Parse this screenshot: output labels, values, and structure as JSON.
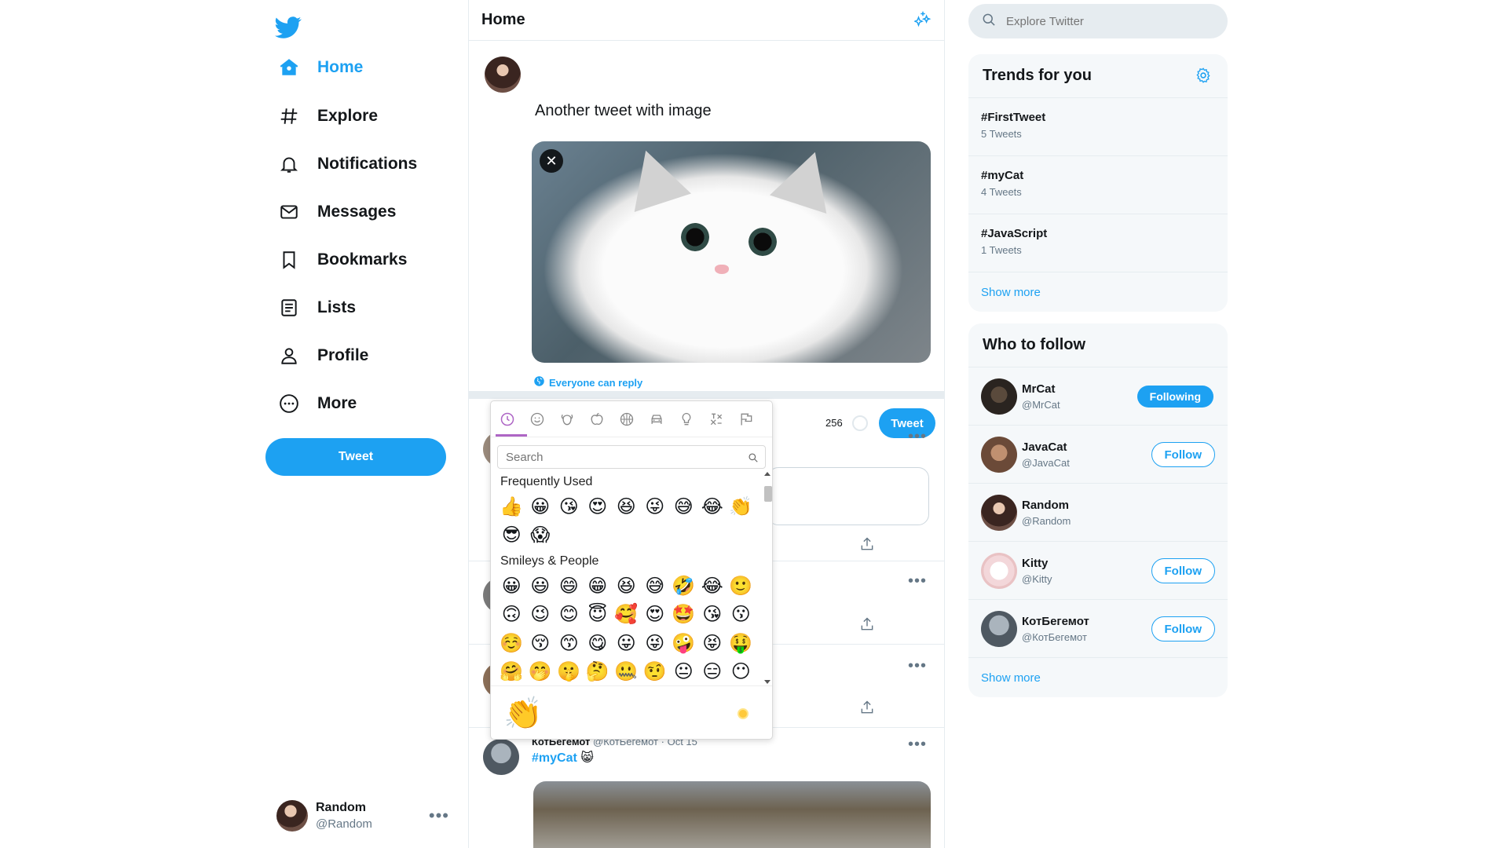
{
  "colors": {
    "accent": "#1da1f2",
    "text": "#14171a",
    "muted": "#657786",
    "border": "#e6ecf0",
    "picker_accent": "#ae65c5"
  },
  "nav": {
    "items": [
      {
        "label": "Home",
        "icon": "home-icon"
      },
      {
        "label": "Explore",
        "icon": "hashtag-icon"
      },
      {
        "label": "Notifications",
        "icon": "bell-icon"
      },
      {
        "label": "Messages",
        "icon": "envelope-icon"
      },
      {
        "label": "Bookmarks",
        "icon": "bookmark-icon"
      },
      {
        "label": "Lists",
        "icon": "list-icon"
      },
      {
        "label": "Profile",
        "icon": "person-icon"
      },
      {
        "label": "More",
        "icon": "more-circle-icon"
      }
    ],
    "tweet_label": "Tweet"
  },
  "account": {
    "name": "Random",
    "handle": "@Random"
  },
  "header": {
    "title": "Home"
  },
  "compose": {
    "text": "Another tweet with image",
    "reply_setting": "Everyone can reply",
    "counter": "256",
    "tweet_label": "Tweet"
  },
  "feed": {
    "last_item": {
      "name": "КотБегемот",
      "handle": "@КотБегемот",
      "sep": "·",
      "date": "Oct 15",
      "hashtag": "#myCat",
      "emoji": "😸"
    }
  },
  "emoji_picker": {
    "search_placeholder": "Search",
    "sections": [
      {
        "label": "Frequently Used",
        "emojis": [
          "👍",
          "😀",
          "😘",
          "😍",
          "😆",
          "😜",
          "😅",
          "😂",
          "👏",
          "😎",
          "😱"
        ]
      },
      {
        "label": "Smileys & People",
        "emojis": [
          "😀",
          "😃",
          "😄",
          "😁",
          "😆",
          "😅",
          "🤣",
          "😂",
          "🙂",
          "🙃",
          "😉",
          "😊",
          "😇",
          "🥰",
          "😍",
          "🤩",
          "😘",
          "😗",
          "☺️",
          "😚",
          "😙",
          "😋",
          "😛",
          "😜",
          "🤪",
          "😝",
          "🤑",
          "🤗",
          "🤭",
          "🤫",
          "🤔",
          "🤐",
          "🤨",
          "😐",
          "😑",
          "😶"
        ]
      }
    ],
    "preview": "👏"
  },
  "right": {
    "search_placeholder": "Explore Twitter",
    "trends_title": "Trends for you",
    "trends": [
      {
        "tag": "#FirstTweet",
        "count": "5 Tweets"
      },
      {
        "tag": "#myCat",
        "count": "4 Tweets"
      },
      {
        "tag": "#JavaScript",
        "count": "1 Tweets"
      }
    ],
    "show_more": "Show more",
    "follow_title": "Who to follow",
    "follow": [
      {
        "name": "MrCat",
        "handle": "@MrCat",
        "action": "Following"
      },
      {
        "name": "JavaCat",
        "handle": "@JavaCat",
        "action": "Follow"
      },
      {
        "name": "Random",
        "handle": "@Random",
        "action": ""
      },
      {
        "name": "Kitty",
        "handle": "@Kitty",
        "action": "Follow"
      },
      {
        "name": "КотБегемот",
        "handle": "@КотБегемот",
        "action": "Follow"
      }
    ],
    "follow_show_more": "Show more"
  }
}
